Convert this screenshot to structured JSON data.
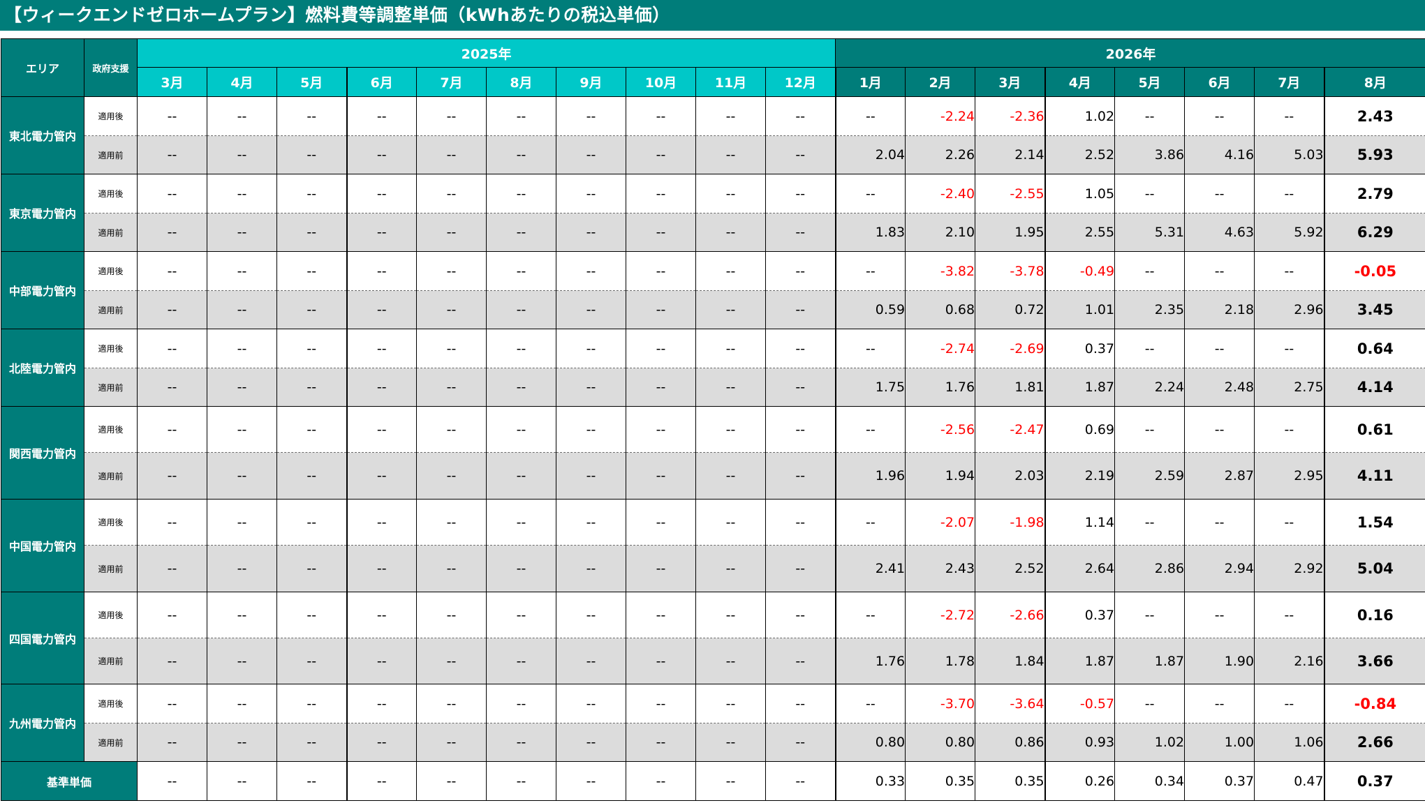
{
  "title": "【ウィークエンドゼロホームプラン】燃料費等調整単価（kWhあたりの税込単価）",
  "header": {
    "area_label": "エリア",
    "support_label": "政府支援",
    "years": [
      {
        "label": "2025年",
        "span": 10,
        "style": "light"
      },
      {
        "label": "2026年",
        "span": 8,
        "style": "dark"
      }
    ],
    "months": [
      "3月",
      "4月",
      "5月",
      "6月",
      "7月",
      "8月",
      "9月",
      "10月",
      "11月",
      "12月",
      "1月",
      "2月",
      "3月",
      "4月",
      "5月",
      "6月",
      "7月",
      "8月"
    ]
  },
  "support_labels": {
    "after": "適用後",
    "before": "適用前"
  },
  "regions": [
    {
      "name": "東北電力管内",
      "after": [
        "--",
        "--",
        "--",
        "--",
        "--",
        "--",
        "--",
        "--",
        "--",
        "--",
        "--",
        "-2.24",
        "-2.36",
        "1.02",
        "--",
        "--",
        "--",
        "2.43"
      ],
      "before": [
        "--",
        "--",
        "--",
        "--",
        "--",
        "--",
        "--",
        "--",
        "--",
        "--",
        "2.04",
        "2.26",
        "2.14",
        "2.52",
        "3.86",
        "4.16",
        "5.03",
        "5.93"
      ]
    },
    {
      "name": "東京電力管内",
      "after": [
        "--",
        "--",
        "--",
        "--",
        "--",
        "--",
        "--",
        "--",
        "--",
        "--",
        "--",
        "-2.40",
        "-2.55",
        "1.05",
        "--",
        "--",
        "--",
        "2.79"
      ],
      "before": [
        "--",
        "--",
        "--",
        "--",
        "--",
        "--",
        "--",
        "--",
        "--",
        "--",
        "1.83",
        "2.10",
        "1.95",
        "2.55",
        "5.31",
        "4.63",
        "5.92",
        "6.29"
      ]
    },
    {
      "name": "中部電力管内",
      "after": [
        "--",
        "--",
        "--",
        "--",
        "--",
        "--",
        "--",
        "--",
        "--",
        "--",
        "--",
        "-3.82",
        "-3.78",
        "-0.49",
        "--",
        "--",
        "--",
        "-0.05"
      ],
      "before": [
        "--",
        "--",
        "--",
        "--",
        "--",
        "--",
        "--",
        "--",
        "--",
        "--",
        "0.59",
        "0.68",
        "0.72",
        "1.01",
        "2.35",
        "2.18",
        "2.96",
        "3.45"
      ]
    },
    {
      "name": "北陸電力管内",
      "after": [
        "--",
        "--",
        "--",
        "--",
        "--",
        "--",
        "--",
        "--",
        "--",
        "--",
        "--",
        "-2.74",
        "-2.69",
        "0.37",
        "--",
        "--",
        "--",
        "0.64"
      ],
      "before": [
        "--",
        "--",
        "--",
        "--",
        "--",
        "--",
        "--",
        "--",
        "--",
        "--",
        "1.75",
        "1.76",
        "1.81",
        "1.87",
        "2.24",
        "2.48",
        "2.75",
        "4.14"
      ]
    },
    {
      "name": "関西電力管内",
      "after": [
        "--",
        "--",
        "--",
        "--",
        "--",
        "--",
        "--",
        "--",
        "--",
        "--",
        "--",
        "-2.56",
        "-2.47",
        "0.69",
        "--",
        "--",
        "--",
        "0.61"
      ],
      "before": [
        "--",
        "--",
        "--",
        "--",
        "--",
        "--",
        "--",
        "--",
        "--",
        "--",
        "1.96",
        "1.94",
        "2.03",
        "2.19",
        "2.59",
        "2.87",
        "2.95",
        "4.11"
      ]
    },
    {
      "name": "中国電力管内",
      "after": [
        "--",
        "--",
        "--",
        "--",
        "--",
        "--",
        "--",
        "--",
        "--",
        "--",
        "--",
        "-2.07",
        "-1.98",
        "1.14",
        "--",
        "--",
        "--",
        "1.54"
      ],
      "before": [
        "--",
        "--",
        "--",
        "--",
        "--",
        "--",
        "--",
        "--",
        "--",
        "--",
        "2.41",
        "2.43",
        "2.52",
        "2.64",
        "2.86",
        "2.94",
        "2.92",
        "5.04"
      ]
    },
    {
      "name": "四国電力管内",
      "after": [
        "--",
        "--",
        "--",
        "--",
        "--",
        "--",
        "--",
        "--",
        "--",
        "--",
        "--",
        "-2.72",
        "-2.66",
        "0.37",
        "--",
        "--",
        "--",
        "0.16"
      ],
      "before": [
        "--",
        "--",
        "--",
        "--",
        "--",
        "--",
        "--",
        "--",
        "--",
        "--",
        "1.76",
        "1.78",
        "1.84",
        "1.87",
        "1.87",
        "1.90",
        "2.16",
        "3.66"
      ]
    },
    {
      "name": "九州電力管内",
      "after": [
        "--",
        "--",
        "--",
        "--",
        "--",
        "--",
        "--",
        "--",
        "--",
        "--",
        "--",
        "-3.70",
        "-3.64",
        "-0.57",
        "--",
        "--",
        "--",
        "-0.84"
      ],
      "before": [
        "--",
        "--",
        "--",
        "--",
        "--",
        "--",
        "--",
        "--",
        "--",
        "--",
        "0.80",
        "0.80",
        "0.86",
        "0.93",
        "1.02",
        "1.00",
        "1.06",
        "2.66"
      ]
    }
  ],
  "base": {
    "label": "基準単価",
    "values": [
      "--",
      "--",
      "--",
      "--",
      "--",
      "--",
      "--",
      "--",
      "--",
      "--",
      "0.33",
      "0.35",
      "0.35",
      "0.26",
      "0.34",
      "0.37",
      "0.47",
      "0.37"
    ]
  },
  "colors": {
    "dark_teal": "#007d7a",
    "light_teal": "#00c8c8",
    "negative": "#ff0000",
    "shaded_row": "#dcdcdc"
  }
}
